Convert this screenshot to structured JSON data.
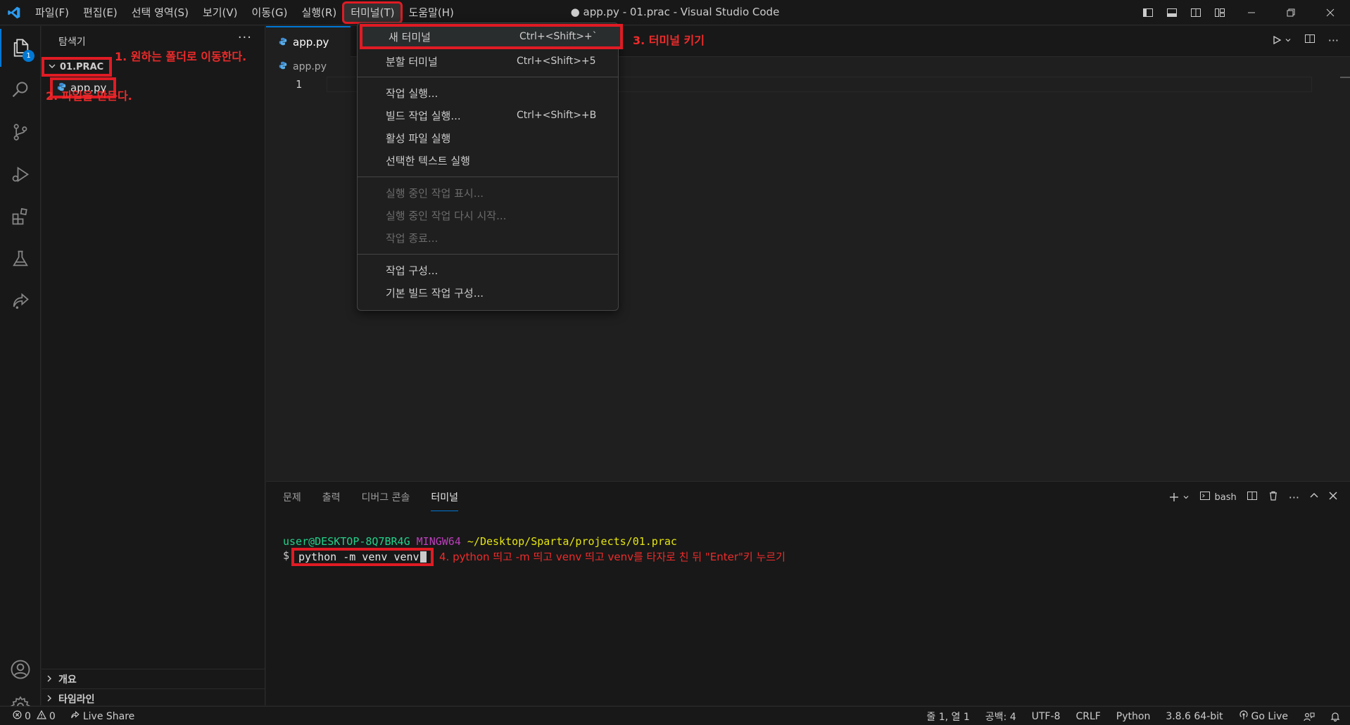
{
  "window_title": "● app.py - 01.prac - Visual Studio Code",
  "menu": [
    "파일(F)",
    "편집(E)",
    "선택 영역(S)",
    "보기(V)",
    "이동(G)",
    "실행(R)",
    "터미널(T)",
    "도움말(H)"
  ],
  "activity": {
    "explorer_badge": "1"
  },
  "sidebar": {
    "title": "탐색기",
    "more": "···",
    "folder": "01.PRAC",
    "file": "app.py",
    "sections": [
      "개요",
      "타임라인"
    ]
  },
  "annotations": {
    "a1": "1. 원하는 폴더로 이동한다.",
    "a2": "2. 파일을 만든다.",
    "a3": "3. 터미널 키기",
    "a4": "4. python 띄고 -m 띄고 venv 띄고 venv를 타자로 친 뒤 \"Enter\"키 누르기"
  },
  "editor": {
    "tab": "app.py",
    "breadcrumb": "app.py",
    "line_number": "1"
  },
  "dropdown": {
    "items": [
      {
        "label": "새 터미널",
        "shortcut": "Ctrl+<Shift>+`"
      },
      {
        "label": "분할 터미널",
        "shortcut": "Ctrl+<Shift>+5"
      },
      {
        "label": "작업 실행...",
        "shortcut": ""
      },
      {
        "label": "빌드 작업 실행...",
        "shortcut": "Ctrl+<Shift>+B"
      },
      {
        "label": "활성 파일 실행",
        "shortcut": ""
      },
      {
        "label": "선택한 텍스트 실행",
        "shortcut": ""
      },
      {
        "label": "실행 중인 작업 표시...",
        "shortcut": ""
      },
      {
        "label": "실행 중인 작업 다시 시작...",
        "shortcut": ""
      },
      {
        "label": "작업 종료...",
        "shortcut": ""
      },
      {
        "label": "작업 구성...",
        "shortcut": ""
      },
      {
        "label": "기본 빌드 작업 구성...",
        "shortcut": ""
      }
    ]
  },
  "panel": {
    "tabs": [
      "문제",
      "출력",
      "디버그 콘솔",
      "터미널"
    ],
    "shell": "bash",
    "prompt_user": "user@DESKTOP-8Q7BR4G",
    "prompt_env": "MINGW64",
    "prompt_path": "~/Desktop/Sparta/projects/01.prac",
    "prompt_symbol": "$",
    "command": "python -m venv venv"
  },
  "status": {
    "errors": "0",
    "warnings": "0",
    "live_share": "Live Share",
    "position": "줄 1, 열 1",
    "spaces": "공백: 4",
    "encoding": "UTF-8",
    "eol": "CRLF",
    "language": "Python",
    "interpreter": "3.8.6 64-bit",
    "go_live": "Go Live"
  },
  "colors": {
    "accent": "#0078d4",
    "highlight_box": "#e01b24",
    "annotation": "#ee2b2b"
  }
}
